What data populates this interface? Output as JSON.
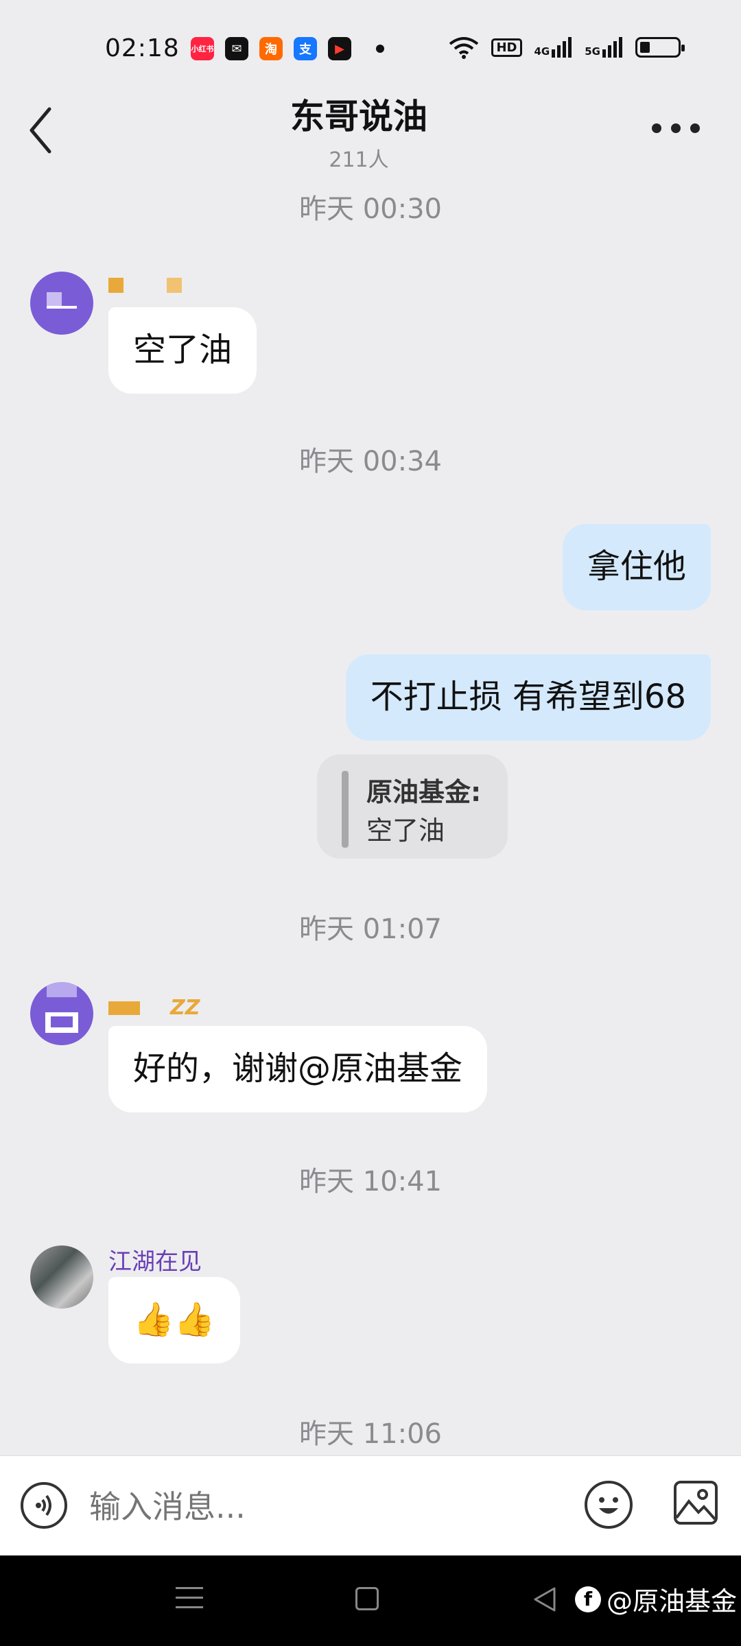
{
  "status_bar": {
    "time": "02:18",
    "app_icons": [
      {
        "name": "xiaohongshu-icon",
        "label": "小红书",
        "color": "#ff2442"
      },
      {
        "name": "mail-icon",
        "label": "✉",
        "color": "#111111"
      },
      {
        "name": "taobao-icon",
        "label": "淘",
        "color": "#ff6a00"
      },
      {
        "name": "alipay-icon",
        "label": "支",
        "color": "#1677ff"
      },
      {
        "name": "video-icon",
        "label": "▶",
        "color": "#111111"
      }
    ],
    "wifi": "wifi-icon",
    "hd": "HD",
    "net1": "4G",
    "net2": "5G",
    "battery_level": 0.2
  },
  "header": {
    "title": "东哥说油",
    "member_count": "211人"
  },
  "messages": {
    "ts1": "昨天 00:30",
    "m1": {
      "sender": "",
      "text": "空了油"
    },
    "ts2": "昨天 00:34",
    "m2": {
      "text": "拿住他"
    },
    "m3": {
      "text": "不打止损   有希望到68"
    },
    "m3_quote": {
      "name": "原油基金:",
      "text": "空了油"
    },
    "ts3": "昨天 01:07",
    "m4": {
      "sender": "ZZ",
      "text": "好的，谢谢@原油基金"
    },
    "ts4": "昨天 10:41",
    "m5": {
      "sender": "江湖在见",
      "text": "👍👍"
    },
    "ts5": "昨天 11:06"
  },
  "input_bar": {
    "placeholder": "输入消息..."
  },
  "watermark": {
    "text": "@原油基金"
  },
  "colors": {
    "background": "#ededf0",
    "bubble_right": "#d4e9fc",
    "bubble_left": "#ffffff",
    "avatar_purple": "#7a5cd6",
    "sender_purple": "#6a3fb5"
  }
}
